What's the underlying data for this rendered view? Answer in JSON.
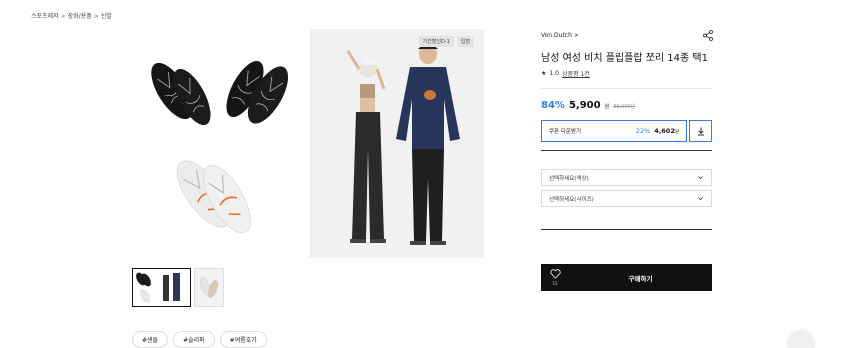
{
  "breadcrumb": [
    "스포츠레저",
    "장화/용품",
    "신발"
  ],
  "breadcrumb_sep": ">",
  "gallery": {
    "badges": [
      "기간할인D-1",
      "입점"
    ],
    "thumb_count": 2
  },
  "tags": [
    "#샌들",
    "#슬리퍼",
    "#여름호가"
  ],
  "product": {
    "brand": "Von Dutch",
    "brand_chevron": ">",
    "title": "남성 여성 비치 플립플랍 쪼리 14종 택1",
    "rating_star": "★",
    "rating_value": "1.0",
    "review_text": "상품평 1건",
    "discount": "84%",
    "price": "5,900",
    "price_unit": "원",
    "original_price": "38,900원"
  },
  "coupon": {
    "label": "쿠폰 다운받기",
    "percent": "22%",
    "price": "4,602",
    "unit": "원",
    "icon": "download-icon"
  },
  "options": [
    {
      "placeholder": "선택하세요(색상)"
    },
    {
      "placeholder": "선택하세요(사이즈)"
    }
  ],
  "actions": {
    "like_count": "15",
    "like_icon": "heart-icon",
    "buy_label": "구매하기"
  },
  "colors": {
    "accent": "#2f80ed",
    "dark": "#111111",
    "border": "#dcdcdc"
  }
}
